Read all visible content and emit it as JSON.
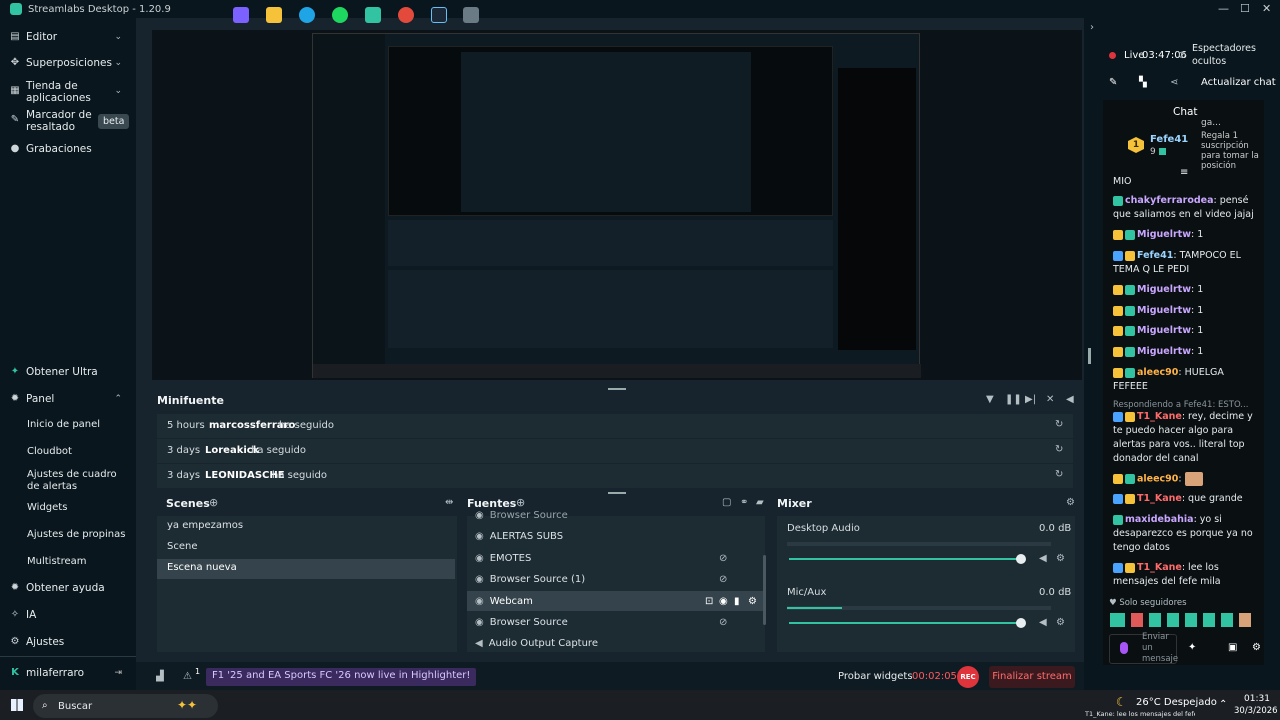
{
  "app": {
    "title": "Streamlabs Desktop - 1.20.9"
  },
  "sidebar": {
    "top_items": [
      {
        "label": "Editor"
      },
      {
        "label": "Superposiciones"
      },
      {
        "label": "Tienda de aplicaciones"
      },
      {
        "label": "Marcador de resaltado",
        "badge": "beta"
      },
      {
        "label": "Grabaciones"
      }
    ],
    "bottom": {
      "ultra": "Obtener Ultra",
      "panel": "Panel",
      "panel_items": [
        "Inicio de panel",
        "Cloudbot",
        "Ajustes de cuadro de alertas",
        "Widgets",
        "Ajustes de propinas",
        "Multistream"
      ],
      "help": "Obtener ayuda",
      "ia": "IA",
      "settings": "Ajustes",
      "user": "milaferraro"
    }
  },
  "minifeed": {
    "title": "Minifuente",
    "rows": [
      {
        "time": "5 hours",
        "user": "marcossferraro",
        "action": "ha seguido"
      },
      {
        "time": "3 days",
        "user": "Loreakick",
        "action": "ha seguido"
      },
      {
        "time": "3 days",
        "user": "LEONIDASCHE",
        "action": "ha seguido"
      }
    ]
  },
  "scenes": {
    "title": "Scenes",
    "items": [
      "ya empezamos",
      "Scene",
      "Escena nueva"
    ],
    "selected": 2
  },
  "sources": {
    "title": "Fuentes",
    "partial_top": "Browser Source",
    "items": [
      "ALERTAS SUBS",
      "EMOTES",
      "Browser Source (1)",
      "Webcam",
      "Browser Source",
      "Audio Output Capture"
    ],
    "selected": 3
  },
  "mixer": {
    "title": "Mixer",
    "channels": [
      {
        "name": "Desktop Audio",
        "db": "0.0 dB",
        "level": 1.0
      },
      {
        "name": "Mic/Aux",
        "db": "0.0 dB",
        "level": 1.0
      }
    ]
  },
  "footer": {
    "count": "1",
    "promo": "F1 '25 and EA Sports FC '26 now live in Highlighter!",
    "test_widgets": "Probar widgets",
    "timer": "00:02:05",
    "rec": "REC",
    "end_stream": "Finalizar stream"
  },
  "live": {
    "label": "Live",
    "time": "03:47:06",
    "viewers": "Espectadores ocultos",
    "refresh_chat": "Actualizar chat"
  },
  "chat": {
    "title": "Chat",
    "top_user": {
      "name": "Fefe41",
      "count": "9",
      "rank": "1"
    },
    "gift_text": "Regala 1 suscripción para tomar la posición",
    "partial_name": "ga...",
    "lines": [
      {
        "user": "",
        "text": "MIO",
        "color": "#e6ecee"
      },
      {
        "user": "chakyferrarodea",
        "text": ": pensé que saliamos en el video jajaj",
        "color": "#c9a7ff"
      },
      {
        "user": "Miguelrtw",
        "text": ": 1",
        "color": "#c9a7ff"
      },
      {
        "user": "Fefe41",
        "text": ": TAMPOCO EL TEMA Q LE PEDI",
        "color": "#9bd5ff"
      },
      {
        "user": "Miguelrtw",
        "text": ": 1",
        "color": "#c9a7ff"
      },
      {
        "user": "Miguelrtw",
        "text": ": 1",
        "color": "#c9a7ff"
      },
      {
        "user": "Miguelrtw",
        "text": ": 1",
        "color": "#c9a7ff"
      },
      {
        "user": "Miguelrtw",
        "text": ": 1",
        "color": "#c9a7ff"
      },
      {
        "user": "aleec90",
        "text": ": HUELGA FEFEEE",
        "color": "#ffb347"
      }
    ],
    "reply_note": "Respondiendo a Fefe41: ESTO...",
    "lines2": [
      {
        "user": "T1_Kane",
        "text": ": rey, decime y te puedo hacer algo para alertas para vos.. literal top donador del canal",
        "color": "#ff6b6b"
      },
      {
        "user": "aleec90",
        "text": ":",
        "color": "#ffb347"
      },
      {
        "user": "T1_Kane",
        "text": ": que grande",
        "color": "#ff6b6b"
      },
      {
        "user": "maxidebahia",
        "text": ": yo si desaparezco es porque ya no tengo datos",
        "color": "#c9a7ff"
      },
      {
        "user": "T1_Kane",
        "text": ": lee los mensajes del fefe mila",
        "color": "#ff6b6b"
      }
    ],
    "followers_only": "Solo seguidores",
    "send_placeholder": "Enviar un mensaje"
  },
  "taskbar": {
    "search": "Buscar",
    "weather": "26°C Despejado",
    "ticker": "T1_Kane: lee los mensajes del fefe mila",
    "time": "01:31",
    "date": "30/3/2026"
  },
  "colors": {
    "accent": "#31c3a2",
    "bg": "#17242d",
    "sidebar": "#09161d",
    "rec": "#e0343d",
    "promo": "#3a2a5e"
  }
}
